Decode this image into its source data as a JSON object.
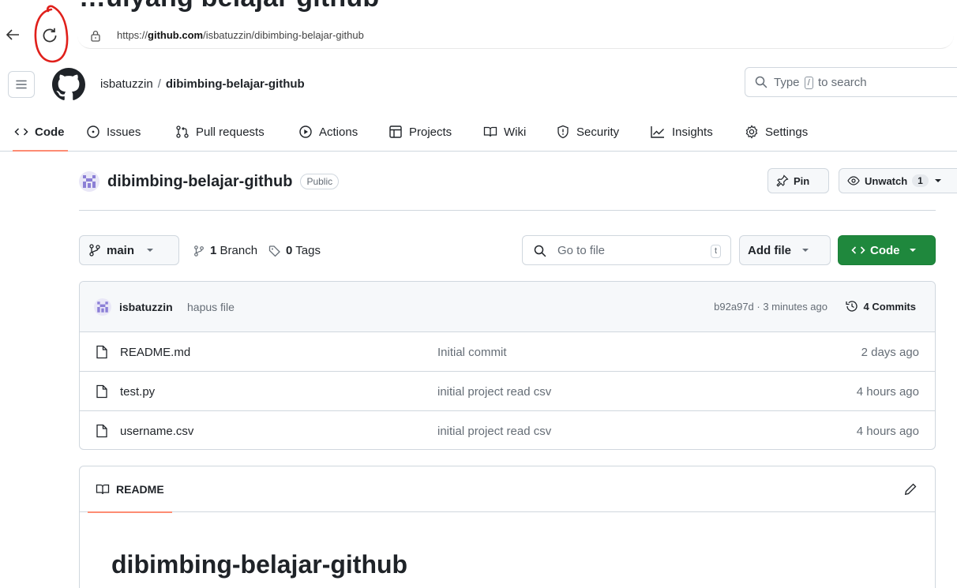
{
  "page_heading": "…ulyang belajar github",
  "browser": {
    "url_prefix": "https://",
    "url_host": "github.com",
    "url_path": "/isbatuzzin/dibimbing-belajar-github"
  },
  "header": {
    "owner": "isbatuzzin",
    "separator": "/",
    "repo": "dibimbing-belajar-github",
    "search_pre": "Type",
    "search_key": "/",
    "search_post": "to search"
  },
  "tabs": [
    {
      "label": "Code",
      "icon": "code-icon"
    },
    {
      "label": "Issues",
      "icon": "issue-icon"
    },
    {
      "label": "Pull requests",
      "icon": "pull-request-icon"
    },
    {
      "label": "Actions",
      "icon": "play-icon"
    },
    {
      "label": "Projects",
      "icon": "table-icon"
    },
    {
      "label": "Wiki",
      "icon": "book-icon"
    },
    {
      "label": "Security",
      "icon": "shield-icon"
    },
    {
      "label": "Insights",
      "icon": "graph-icon"
    },
    {
      "label": "Settings",
      "icon": "gear-icon"
    }
  ],
  "repo": {
    "name": "dibimbing-belajar-github",
    "visibility": "Public",
    "pin_label": "Pin",
    "unwatch_label": "Unwatch",
    "watch_count": "1"
  },
  "branch_bar": {
    "branch": "main",
    "branch_count": "1",
    "branch_word": "Branch",
    "tag_count": "0",
    "tag_word": "Tags",
    "goto_placeholder": "Go to file",
    "goto_key": "t",
    "add_file_label": "Add file",
    "code_label": "Code"
  },
  "latest_commit": {
    "user": "isbatuzzin",
    "message": "hapus file",
    "hash_time": "b92a97d · 3 minutes ago",
    "commits_count": "4",
    "commits_word": "Commits"
  },
  "files": [
    {
      "name": "README.md",
      "message": "Initial commit",
      "time": "2 days ago"
    },
    {
      "name": "test.py",
      "message": "initial project read csv",
      "time": "4 hours ago"
    },
    {
      "name": "username.csv",
      "message": "initial project read csv",
      "time": "4 hours ago"
    }
  ],
  "readme": {
    "tab_label": "README",
    "heading": "dibimbing-belajar-github"
  },
  "colors": {
    "accent_underline": "#fd8c73",
    "code_button": "#1f883d",
    "annotation_circle": "#e0201b"
  }
}
